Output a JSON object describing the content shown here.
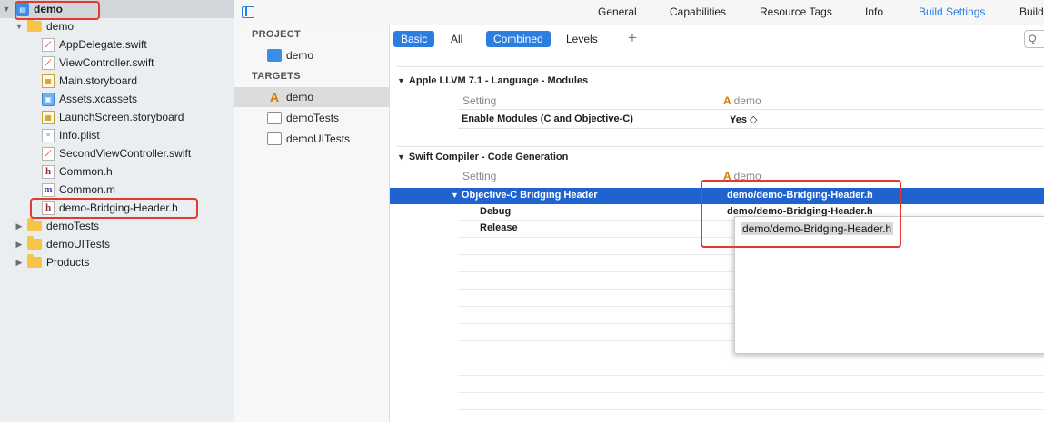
{
  "navigator": {
    "items": [
      {
        "label": "demo",
        "icon": "project-icon",
        "disclosure": "▼"
      },
      {
        "label": "demo",
        "icon": "folder-icon",
        "disclosure": "▼"
      },
      {
        "label": "AppDelegate.swift",
        "icon": "swift-file-icon"
      },
      {
        "label": "ViewController.swift",
        "icon": "swift-file-icon"
      },
      {
        "label": "Main.storyboard",
        "icon": "storyboard-icon"
      },
      {
        "label": "Assets.xcassets",
        "icon": "assets-icon"
      },
      {
        "label": "LaunchScreen.storyboard",
        "icon": "storyboard-icon"
      },
      {
        "label": "Info.plist",
        "icon": "plist-icon"
      },
      {
        "label": "SecondViewController.swift",
        "icon": "swift-file-icon"
      },
      {
        "label": "Common.h",
        "icon": "header-file-icon"
      },
      {
        "label": "Common.m",
        "icon": "objc-file-icon"
      },
      {
        "label": "demo-Bridging-Header.h",
        "icon": "header-file-icon"
      },
      {
        "label": "demoTests",
        "icon": "folder-icon",
        "disclosure": "▶"
      },
      {
        "label": "demoUITests",
        "icon": "folder-icon",
        "disclosure": "▶"
      },
      {
        "label": "Products",
        "icon": "folder-icon",
        "disclosure": "▶"
      }
    ],
    "icon_glyphs": {
      "h": "h",
      "m": "m"
    }
  },
  "tabs": [
    "General",
    "Capabilities",
    "Resource Tags",
    "Info",
    "Build Settings",
    "Build"
  ],
  "active_tab": "Build Settings",
  "project": {
    "header": "PROJECT",
    "items": [
      "demo"
    ]
  },
  "targets": {
    "header": "TARGETS",
    "items": [
      "demo",
      "demoTests",
      "demoUITests"
    ]
  },
  "filter": {
    "basic": "Basic",
    "all": "All",
    "combined": "Combined",
    "levels": "Levels",
    "search_glyph": "Q"
  },
  "sections": [
    {
      "title": "Apple LLVM 7.1 - Language - Modules",
      "col_setting": "Setting",
      "col_target": "demo",
      "rows": [
        {
          "name": "Enable Modules (C and Objective-C)",
          "value": "Yes ◇"
        }
      ]
    },
    {
      "title": "Swift Compiler - Code Generation",
      "col_setting": "Setting",
      "col_target": "demo",
      "rows": [
        {
          "name": "Objective-C Bridging Header",
          "value": "demo/demo-Bridging-Header.h"
        },
        {
          "name": "Debug",
          "value": "demo/demo-Bridging-Header.h"
        },
        {
          "name": "Release",
          "value": ""
        }
      ]
    }
  ],
  "popup": {
    "text": "demo/demo-Bridging-Header.h"
  },
  "colors": {
    "accent": "#2b7de0",
    "selection": "#1e63cf",
    "annotation": "#e23a2f"
  }
}
